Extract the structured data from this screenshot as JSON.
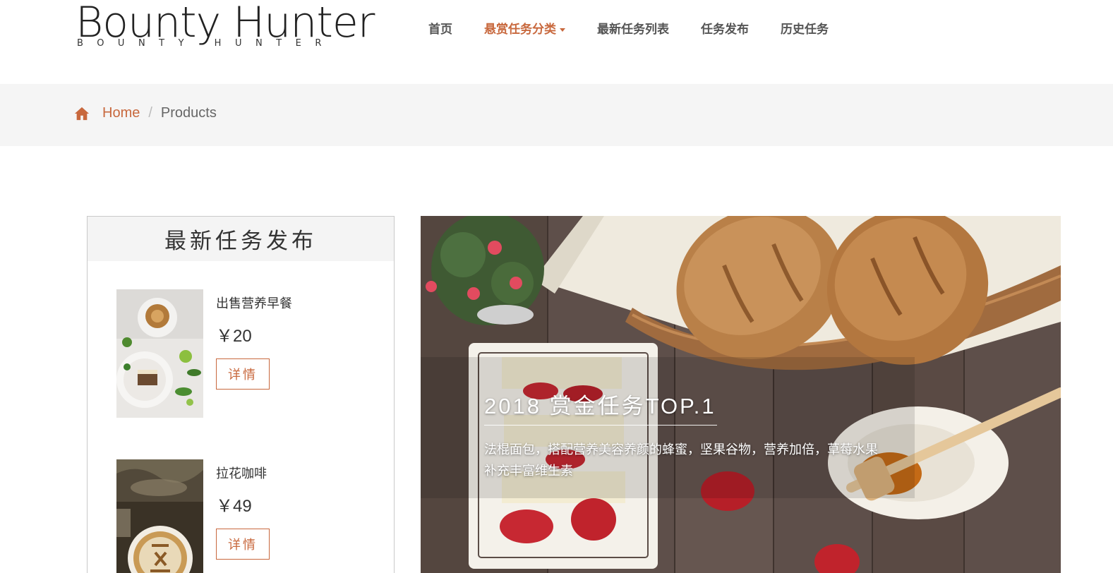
{
  "logo": {
    "main": "Bounty Hunter",
    "sub": "BOUNTY HUNTER"
  },
  "nav": {
    "items": [
      "首页",
      "悬赏任务分类",
      "最新任务列表",
      "任务发布",
      "历史任务"
    ],
    "active_index": 1
  },
  "breadcrumb": {
    "icon": "home-icon",
    "home": "Home",
    "separator": "/",
    "current": "Products"
  },
  "sidebar": {
    "title": "最新任务发布",
    "items": [
      {
        "title": "出售营养早餐",
        "price": "￥20",
        "button": "详情",
        "image": "breakfast-photo"
      },
      {
        "title": "拉花咖啡",
        "price": "￥49",
        "button": "详情",
        "image": "latte-art-photo"
      }
    ]
  },
  "hero": {
    "title": "2018 赏金任务TOP.1",
    "description": "法棍面包，搭配营养美容养颜的蜂蜜，坚果谷物，营养加倍，草莓水果补充丰富维生素",
    "image": "bread-honey-strawberry-photo"
  },
  "colors": {
    "accent": "#c8683d",
    "nav_text": "#555555",
    "crumb_bg": "#f5f5f5"
  }
}
